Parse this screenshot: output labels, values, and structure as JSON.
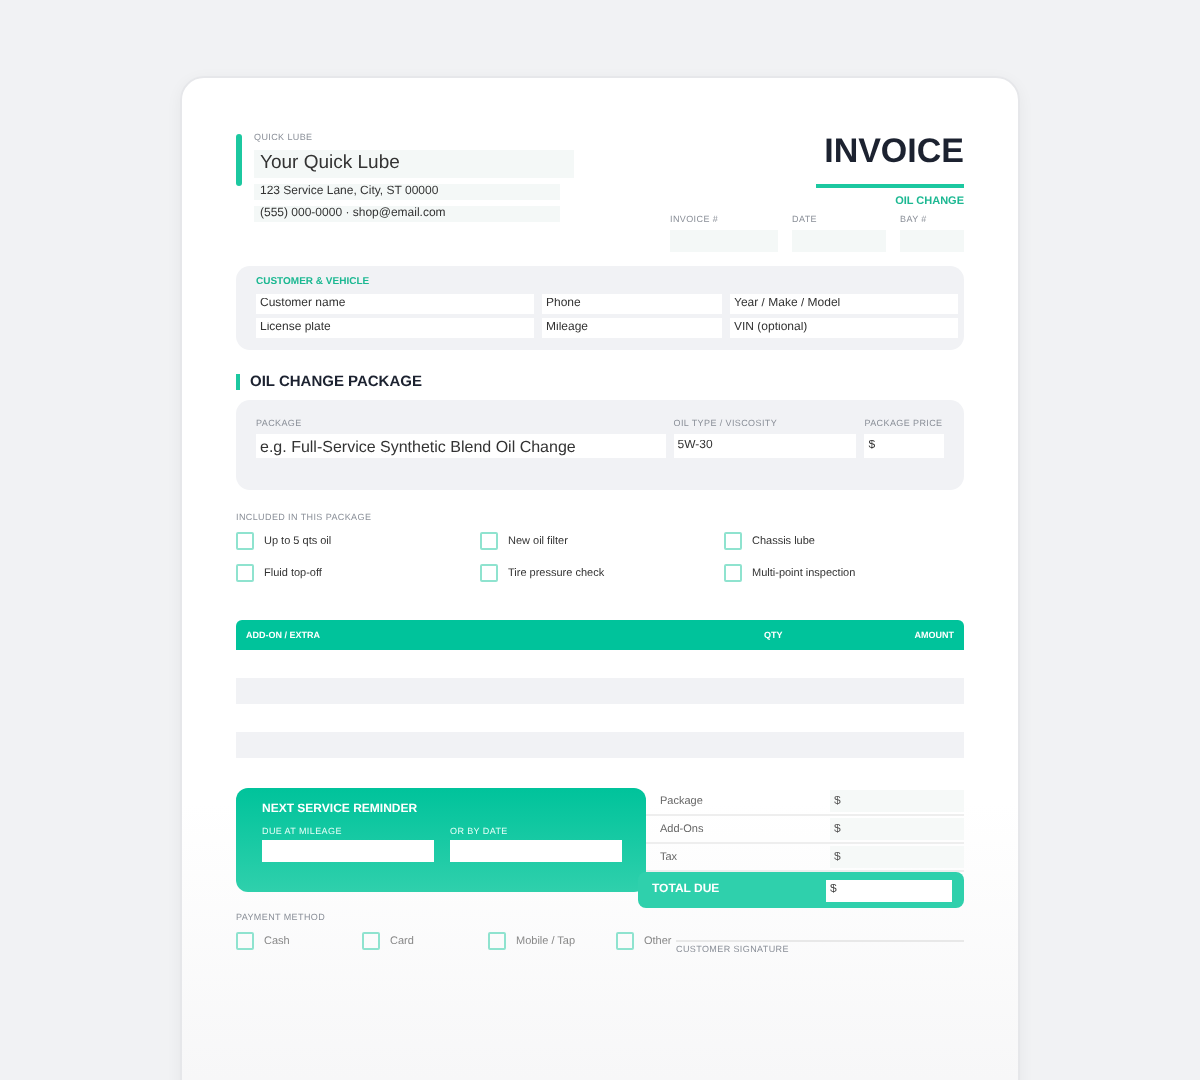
{
  "business": {
    "label": "QUICK LUBE",
    "name": "Your Quick Lube",
    "address": "123 Service Lane, City, ST 00000",
    "contact": "(555) 000-0000 · shop@email.com"
  },
  "invoice": {
    "title": "INVOICE",
    "subtitle": "OIL CHANGE",
    "fields": [
      {
        "label": "INVOICE #"
      },
      {
        "label": "DATE"
      },
      {
        "label": "BAY #"
      }
    ]
  },
  "customer": {
    "title": "CUSTOMER & VEHICLE",
    "fields": [
      {
        "placeholder": "Customer name"
      },
      {
        "placeholder": "Phone"
      },
      {
        "placeholder": "Year / Make / Model"
      },
      {
        "placeholder": "License plate"
      },
      {
        "placeholder": "Mileage"
      },
      {
        "placeholder": "VIN (optional)"
      }
    ]
  },
  "package": {
    "title": "OIL CHANGE PACKAGE",
    "fields": [
      {
        "label": "PACKAGE",
        "placeholder": "e.g. Full-Service Synthetic Blend Oil Change"
      },
      {
        "label": "OIL TYPE / VISCOSITY",
        "placeholder": "5W-30"
      },
      {
        "label": "PACKAGE PRICE",
        "placeholder": "$"
      }
    ]
  },
  "included": {
    "label": "INCLUDED IN THIS PACKAGE",
    "items": [
      {
        "label": "Up to 5 qts oil",
        "checked": false
      },
      {
        "label": "New oil filter",
        "checked": false
      },
      {
        "label": "Chassis lube",
        "checked": false
      },
      {
        "label": "Fluid top-off",
        "checked": false
      },
      {
        "label": "Tire pressure check",
        "checked": false
      },
      {
        "label": "Multi-point inspection",
        "checked": false
      }
    ]
  },
  "table": {
    "columns": [
      "ADD-ON / EXTRA",
      "QTY",
      "AMOUNT"
    ]
  },
  "reminder": {
    "title": "NEXT SERVICE REMINDER",
    "fields": [
      {
        "label": "DUE AT MILEAGE"
      },
      {
        "label": "OR BY DATE"
      }
    ]
  },
  "totals": {
    "lines": [
      {
        "label": "Package",
        "placeholder": "$"
      },
      {
        "label": "Add-Ons",
        "placeholder": "$"
      },
      {
        "label": "Tax",
        "placeholder": "$"
      }
    ],
    "total": {
      "label": "TOTAL DUE",
      "placeholder": "$"
    }
  },
  "payment": {
    "label": "PAYMENT METHOD",
    "options": [
      {
        "label": "Cash",
        "checked": false
      },
      {
        "label": "Card",
        "checked": false
      },
      {
        "label": "Mobile / Tap",
        "checked": false
      },
      {
        "label": "Other",
        "checked": false
      }
    ]
  },
  "signature": {
    "label": "CUSTOMER SIGNATURE"
  }
}
